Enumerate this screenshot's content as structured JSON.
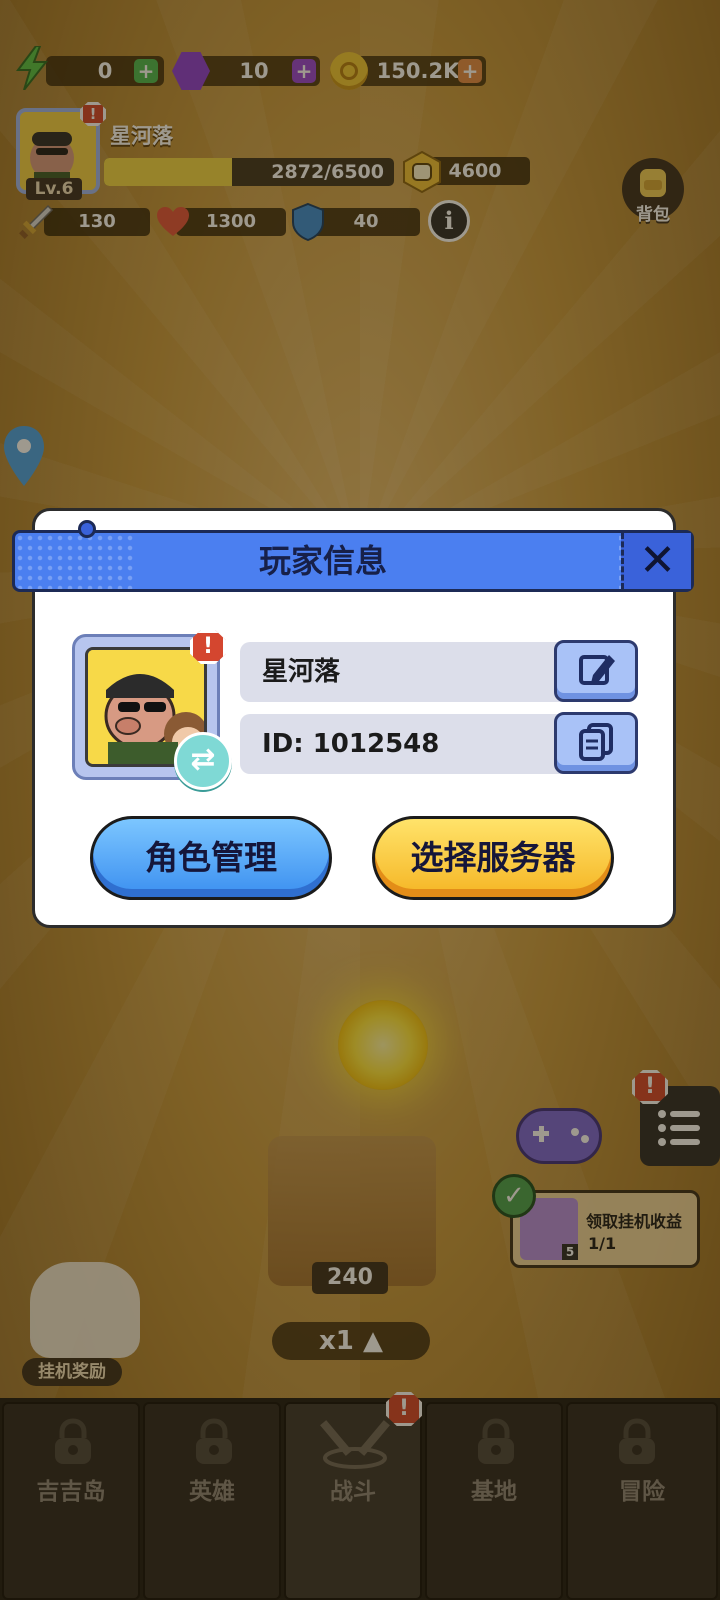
{
  "resources": {
    "energy": {
      "value": "0"
    },
    "gems": {
      "value": "10"
    },
    "coins": {
      "value": "150.2K"
    }
  },
  "player": {
    "name": "星河落",
    "level": "Lv.6",
    "xp_text": "2872/6500",
    "xp_fraction": 0.44,
    "power": "4600",
    "backpack_label": "背包"
  },
  "stats": {
    "attack": "130",
    "hp": "1300",
    "defense": "40"
  },
  "dialog": {
    "title": "玩家信息",
    "name_value": "星河落",
    "id_value": "ID: 1012548",
    "role_button": "角色管理",
    "server_button": "选择服务器",
    "alert_mark": "!"
  },
  "scene": {
    "crate_count": "240",
    "speed": "x1 ▲",
    "idle_title": "领取挂机收益",
    "idle_count": "1/1",
    "idle_badge": "5",
    "afk_reward": "挂机奖励"
  },
  "nav": {
    "tabs": [
      {
        "label": "吉吉岛"
      },
      {
        "label": "英雄"
      },
      {
        "label": "战斗"
      },
      {
        "label": "基地"
      },
      {
        "label": "冒险"
      }
    ]
  },
  "colors": {
    "accent_blue": "#4b7ff0",
    "accent_yellow": "#f5b524",
    "xp_fill": "#f2d84a"
  }
}
